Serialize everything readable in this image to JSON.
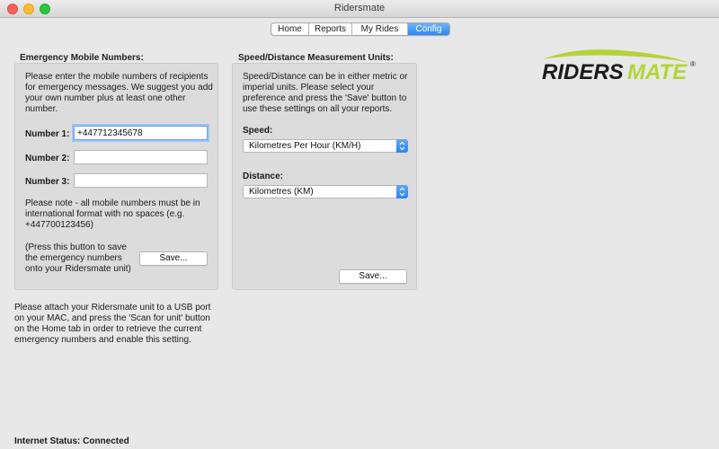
{
  "window": {
    "title": "Ridersmate"
  },
  "tabs": [
    {
      "label": "Home",
      "active": false
    },
    {
      "label": "Reports",
      "active": false
    },
    {
      "label": "My Rides",
      "active": false
    },
    {
      "label": "Config",
      "active": true
    }
  ],
  "emergency": {
    "title": "Emergency Mobile Numbers:",
    "intro": "Please enter the mobile numbers of recipients for emergency messages. We suggest you add your own number plus at least one other number.",
    "number1_label": "Number 1:",
    "number1_value": "+447712345678",
    "number2_label": "Number 2:",
    "number2_value": "",
    "number3_label": "Number 3:",
    "number3_value": "",
    "note": "Please note - all mobile numbers must be in international format with no spaces (e.g. +447700123456)",
    "save_hint": "(Press this button to save the emergency numbers onto your Ridersmate unit)",
    "save_label": "Save..."
  },
  "units": {
    "title": "Speed/Distance Measurement Units:",
    "intro": "Speed/Distance can be in either metric or imperial units. Please select your preference and press the 'Save' button to use these settings on all your reports.",
    "speed_label": "Speed:",
    "speed_value": "Kilometres Per Hour (KM/H)",
    "distance_label": "Distance:",
    "distance_value": "Kilometres (KM)",
    "save_label": "Save..."
  },
  "attach_note": "Please attach your Ridersmate unit to a USB port on your MAC, and press the 'Scan for unit' button on the Home tab in order to retrieve the current emergency numbers and enable this setting.",
  "status": {
    "text": "Internet Status: Connected"
  },
  "logo": {
    "text": "RIDERSMATE",
    "registered": "®"
  },
  "colors": {
    "accent": "#2f87f5",
    "logo_green": "#b6d335",
    "logo_dark": "#1a1a1a"
  }
}
